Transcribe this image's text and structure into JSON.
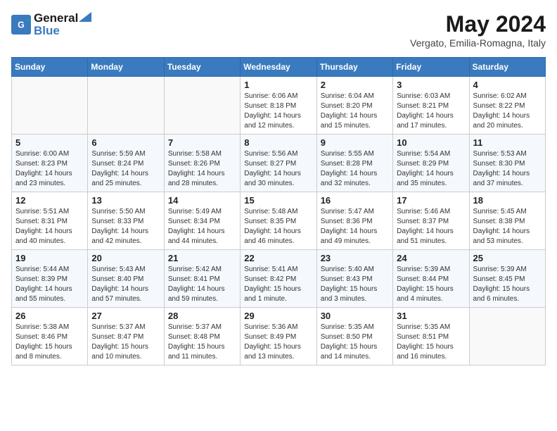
{
  "header": {
    "logo_line1": "General",
    "logo_line2": "Blue",
    "month_title": "May 2024",
    "location": "Vergato, Emilia-Romagna, Italy"
  },
  "days_of_week": [
    "Sunday",
    "Monday",
    "Tuesday",
    "Wednesday",
    "Thursday",
    "Friday",
    "Saturday"
  ],
  "weeks": [
    [
      {
        "day": "",
        "info": ""
      },
      {
        "day": "",
        "info": ""
      },
      {
        "day": "",
        "info": ""
      },
      {
        "day": "1",
        "info": "Sunrise: 6:06 AM\nSunset: 8:18 PM\nDaylight: 14 hours and 12 minutes."
      },
      {
        "day": "2",
        "info": "Sunrise: 6:04 AM\nSunset: 8:20 PM\nDaylight: 14 hours and 15 minutes."
      },
      {
        "day": "3",
        "info": "Sunrise: 6:03 AM\nSunset: 8:21 PM\nDaylight: 14 hours and 17 minutes."
      },
      {
        "day": "4",
        "info": "Sunrise: 6:02 AM\nSunset: 8:22 PM\nDaylight: 14 hours and 20 minutes."
      }
    ],
    [
      {
        "day": "5",
        "info": "Sunrise: 6:00 AM\nSunset: 8:23 PM\nDaylight: 14 hours and 23 minutes."
      },
      {
        "day": "6",
        "info": "Sunrise: 5:59 AM\nSunset: 8:24 PM\nDaylight: 14 hours and 25 minutes."
      },
      {
        "day": "7",
        "info": "Sunrise: 5:58 AM\nSunset: 8:26 PM\nDaylight: 14 hours and 28 minutes."
      },
      {
        "day": "8",
        "info": "Sunrise: 5:56 AM\nSunset: 8:27 PM\nDaylight: 14 hours and 30 minutes."
      },
      {
        "day": "9",
        "info": "Sunrise: 5:55 AM\nSunset: 8:28 PM\nDaylight: 14 hours and 32 minutes."
      },
      {
        "day": "10",
        "info": "Sunrise: 5:54 AM\nSunset: 8:29 PM\nDaylight: 14 hours and 35 minutes."
      },
      {
        "day": "11",
        "info": "Sunrise: 5:53 AM\nSunset: 8:30 PM\nDaylight: 14 hours and 37 minutes."
      }
    ],
    [
      {
        "day": "12",
        "info": "Sunrise: 5:51 AM\nSunset: 8:31 PM\nDaylight: 14 hours and 40 minutes."
      },
      {
        "day": "13",
        "info": "Sunrise: 5:50 AM\nSunset: 8:33 PM\nDaylight: 14 hours and 42 minutes."
      },
      {
        "day": "14",
        "info": "Sunrise: 5:49 AM\nSunset: 8:34 PM\nDaylight: 14 hours and 44 minutes."
      },
      {
        "day": "15",
        "info": "Sunrise: 5:48 AM\nSunset: 8:35 PM\nDaylight: 14 hours and 46 minutes."
      },
      {
        "day": "16",
        "info": "Sunrise: 5:47 AM\nSunset: 8:36 PM\nDaylight: 14 hours and 49 minutes."
      },
      {
        "day": "17",
        "info": "Sunrise: 5:46 AM\nSunset: 8:37 PM\nDaylight: 14 hours and 51 minutes."
      },
      {
        "day": "18",
        "info": "Sunrise: 5:45 AM\nSunset: 8:38 PM\nDaylight: 14 hours and 53 minutes."
      }
    ],
    [
      {
        "day": "19",
        "info": "Sunrise: 5:44 AM\nSunset: 8:39 PM\nDaylight: 14 hours and 55 minutes."
      },
      {
        "day": "20",
        "info": "Sunrise: 5:43 AM\nSunset: 8:40 PM\nDaylight: 14 hours and 57 minutes."
      },
      {
        "day": "21",
        "info": "Sunrise: 5:42 AM\nSunset: 8:41 PM\nDaylight: 14 hours and 59 minutes."
      },
      {
        "day": "22",
        "info": "Sunrise: 5:41 AM\nSunset: 8:42 PM\nDaylight: 15 hours and 1 minute."
      },
      {
        "day": "23",
        "info": "Sunrise: 5:40 AM\nSunset: 8:43 PM\nDaylight: 15 hours and 3 minutes."
      },
      {
        "day": "24",
        "info": "Sunrise: 5:39 AM\nSunset: 8:44 PM\nDaylight: 15 hours and 4 minutes."
      },
      {
        "day": "25",
        "info": "Sunrise: 5:39 AM\nSunset: 8:45 PM\nDaylight: 15 hours and 6 minutes."
      }
    ],
    [
      {
        "day": "26",
        "info": "Sunrise: 5:38 AM\nSunset: 8:46 PM\nDaylight: 15 hours and 8 minutes."
      },
      {
        "day": "27",
        "info": "Sunrise: 5:37 AM\nSunset: 8:47 PM\nDaylight: 15 hours and 10 minutes."
      },
      {
        "day": "28",
        "info": "Sunrise: 5:37 AM\nSunset: 8:48 PM\nDaylight: 15 hours and 11 minutes."
      },
      {
        "day": "29",
        "info": "Sunrise: 5:36 AM\nSunset: 8:49 PM\nDaylight: 15 hours and 13 minutes."
      },
      {
        "day": "30",
        "info": "Sunrise: 5:35 AM\nSunset: 8:50 PM\nDaylight: 15 hours and 14 minutes."
      },
      {
        "day": "31",
        "info": "Sunrise: 5:35 AM\nSunset: 8:51 PM\nDaylight: 15 hours and 16 minutes."
      },
      {
        "day": "",
        "info": ""
      }
    ]
  ]
}
